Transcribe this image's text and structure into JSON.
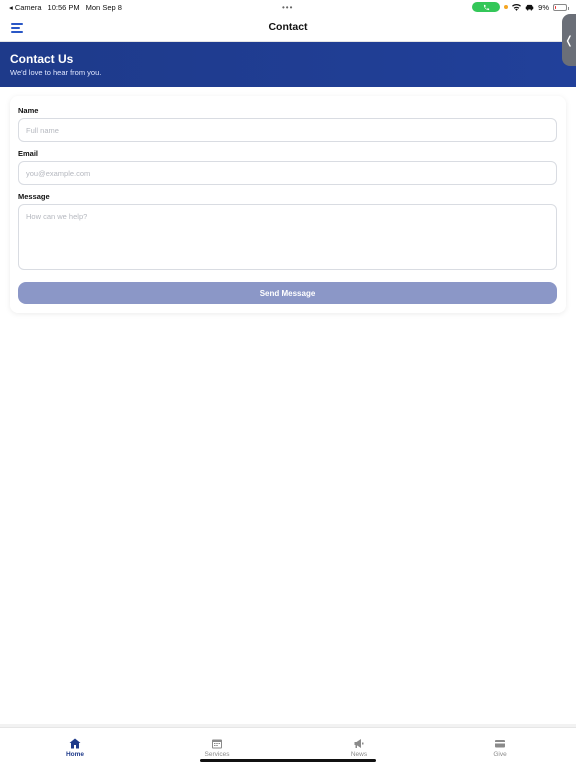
{
  "status_bar": {
    "back_app": "◂ Camera",
    "time": "10:56 PM",
    "date": "Mon Sep 8",
    "battery": "9%",
    "battery_level": 0.09
  },
  "navbar": {
    "title": "Contact"
  },
  "banner": {
    "title": "Contact Us",
    "subtitle": "We'd love to hear from you."
  },
  "side_handle": {
    "glyph": "❬"
  },
  "form": {
    "name_label": "Name",
    "name_placeholder": "Full name",
    "email_label": "Email",
    "email_placeholder": "you@example.com",
    "message_label": "Message",
    "message_placeholder": "How can we help?",
    "submit_label": "Send Message"
  },
  "tabbar": {
    "items": [
      {
        "label": "Home",
        "icon": "home-icon",
        "active": true
      },
      {
        "label": "Services",
        "icon": "calendar-icon",
        "active": false
      },
      {
        "label": "News",
        "icon": "megaphone-icon",
        "active": false
      },
      {
        "label": "Give",
        "icon": "card-icon",
        "active": false
      }
    ]
  },
  "colors": {
    "brand": "#1e3a8a",
    "accent": "#2a57c6",
    "button_disabled": "#8b97c7",
    "call_green": "#34c759"
  }
}
